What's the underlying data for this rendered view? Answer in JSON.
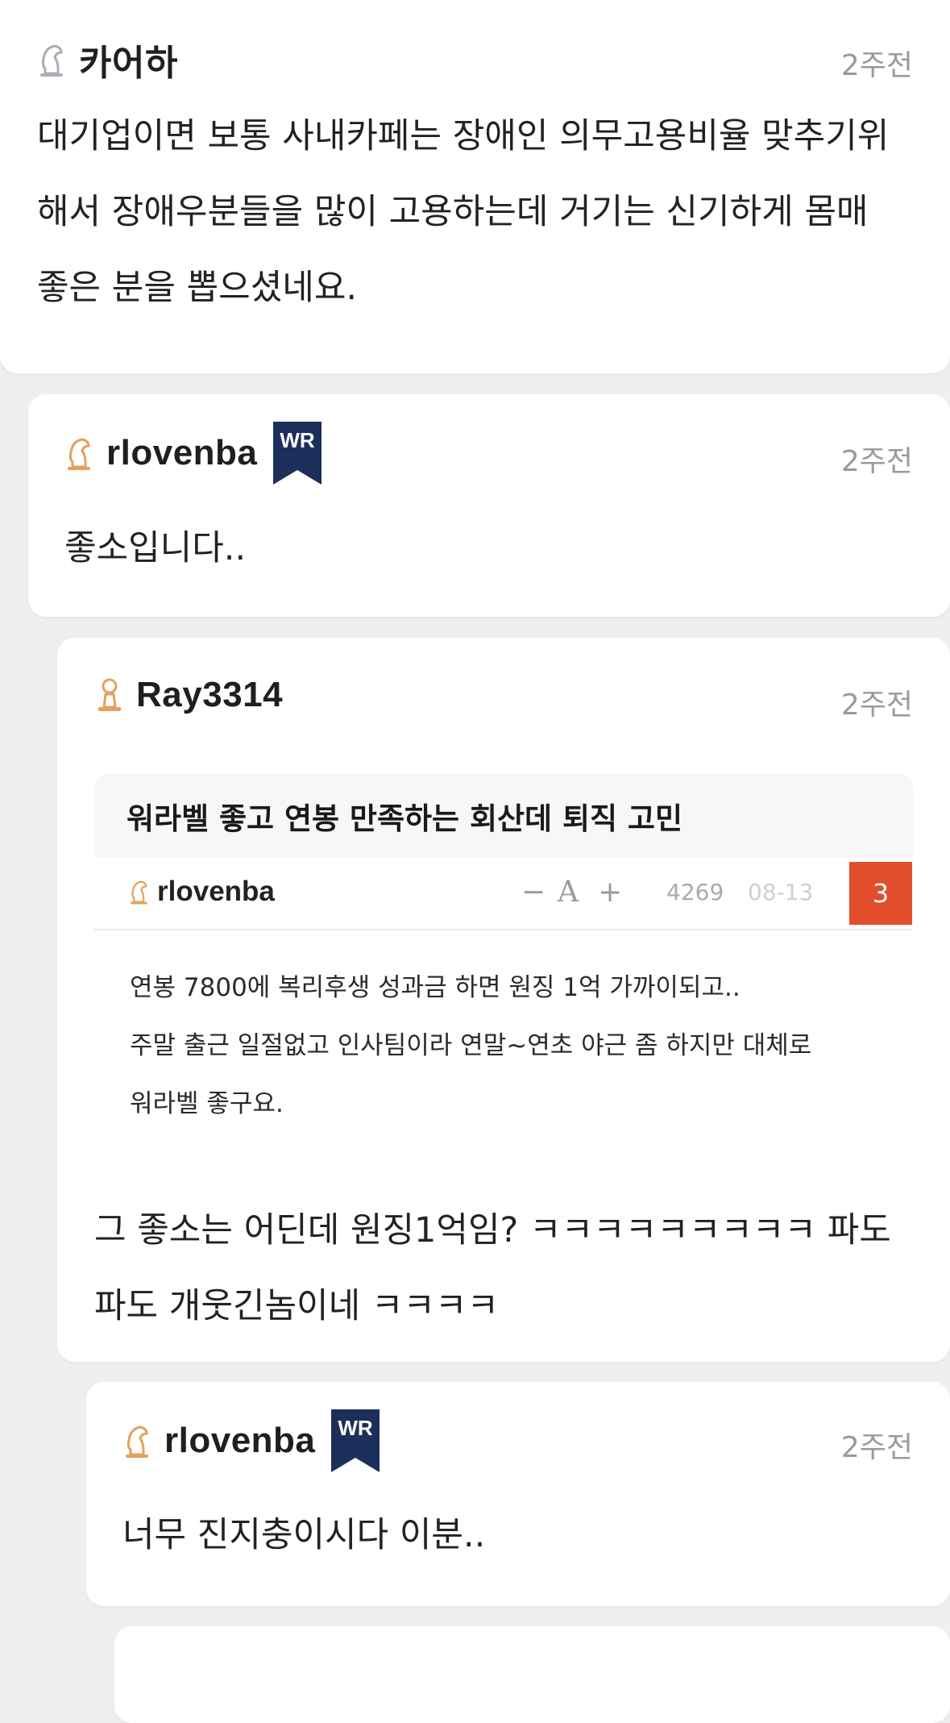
{
  "comments": [
    {
      "username": "카어하",
      "time": "2주전",
      "text_lines": [
        "대기업이면 보통 사내카페는 장애인 의무고용비율 맞추기위",
        "해서 장애우분들을 많이 고용하는데 거기는 신기하게 몸매",
        "좋은 분을 뽑으셨네요."
      ],
      "icon_color": "#a9aeb6"
    },
    {
      "username": "rlovenba",
      "badge": "WR",
      "time": "2주전",
      "text_lines": [
        "좋소입니다.."
      ],
      "icon_color": "#e3a15e"
    },
    {
      "username": "Ray3314",
      "time": "2주전",
      "icon_color": "#e3a15e",
      "quote": {
        "title": "워라벨 좋고 연봉 만족하는 회산데 퇴직 고민",
        "author": "rlovenba",
        "font_minus": "−",
        "font_a": "A",
        "font_plus": "+",
        "views": "4269",
        "date": "08-13",
        "comment_count": "3",
        "body_lines": [
          "연봉 7800에 복리후생 성과금 하면 원징 1억 가까이되고..",
          "주말 출근 일절없고 인사팀이라 연말~연초 야근 좀 하지만 대체로",
          "워라벨 좋구요."
        ]
      },
      "text_lines": [
        "그 좋소는 어딘데 원징1억임? ㅋㅋㅋㅋㅋㅋㅋㅋㅋ 파도",
        "파도 개웃긴놈이네 ㅋㅋㅋㅋ"
      ]
    },
    {
      "username": "rlovenba",
      "badge": "WR",
      "time": "2주전",
      "text_lines": [
        "너무 진지충이시다 이분.."
      ],
      "icon_color": "#e3a15e"
    }
  ],
  "colors": {
    "background": "#efeff1",
    "badge": "#1c2f5a",
    "comment_count_bg": "#e24e2c"
  }
}
